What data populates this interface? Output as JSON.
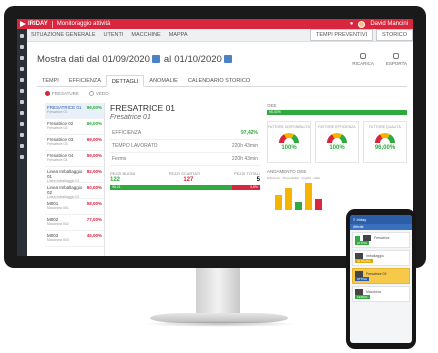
{
  "app": {
    "logo_text": "IRIDAY",
    "title": "Monitoraggio attività",
    "user_name": "David Mancini"
  },
  "nav": {
    "items": [
      "SITUAZIONE GENERALE",
      "UTENTI",
      "MACCHINE",
      "MAPPA"
    ],
    "right_buttons": [
      "TEMPI PREVENTIVI",
      "STORICO"
    ]
  },
  "date_filter": {
    "label": "Mostra dati dal",
    "from": "01/09/2020",
    "connector": "al",
    "to": "01/10/2020",
    "actions": [
      "RICARICA",
      "ESPORTA"
    ]
  },
  "tabs": [
    "TEMPI",
    "EFFICIENZA",
    "DETTAGLI",
    "ANOMALIE",
    "CALENDARIO STORICO"
  ],
  "active_tab": "DETTAGLI",
  "filters": [
    "FRESATURE",
    "VEDO"
  ],
  "machines": [
    {
      "name": "FRESATRICE 01",
      "sub": "Fresatrice 01",
      "pct": "96,00%",
      "status": "green"
    },
    {
      "name": "Fresatrice 02",
      "sub": "Fresatrice 02",
      "pct": "86,00%",
      "status": "green"
    },
    {
      "name": "Fresatrice 03",
      "sub": "Fresatrice 03",
      "pct": "69,00%",
      "status": "red"
    },
    {
      "name": "Fresatrice 04",
      "sub": "Fresatrice 04",
      "pct": "59,00%",
      "status": "red"
    },
    {
      "name": "Linea Imballaggio 01",
      "sub": "Linea Imballaggio 01",
      "pct": "82,00%",
      "status": "red"
    },
    {
      "name": "Linea Imballaggio 02",
      "sub": "Linea Imballaggio 02",
      "pct": "60,00%",
      "status": "red"
    },
    {
      "name": "M001",
      "sub": "Macchina 001",
      "pct": "58,00%",
      "status": "red"
    },
    {
      "name": "M002",
      "sub": "Macchina 002",
      "pct": "77,00%",
      "status": "red"
    },
    {
      "name": "M003",
      "sub": "Macchina 003",
      "pct": "45,00%",
      "status": "red"
    }
  ],
  "detail": {
    "title": "FRESATRICE 01",
    "subtitle": "Fresatrice 01",
    "efficiency_label": "EFFICIENZA",
    "efficiency_value": "97,42%",
    "worked_label": "TEMPO LAVORATO",
    "worked_value": "220h 43min",
    "stop_label": "Fermo",
    "stop_value": "220h 43min",
    "counters": [
      "PEZZI BUONI",
      "PEZZI SCARTATI",
      "PEZZI TOTALI"
    ],
    "good": "122",
    "rejected": "127",
    "total": "5",
    "good_pct": "98,21",
    "bad_pct": "3,8%"
  },
  "oee": {
    "label": "OEE",
    "value": "96,00%",
    "gauges": [
      {
        "label": "FATTORE DISPONIBILITÀ",
        "value": "100%"
      },
      {
        "label": "FATTORE EFFICIENZA",
        "value": "100%"
      },
      {
        "label": "FATTORE QUALITÀ",
        "value": "96,00%"
      }
    ],
    "trend_label": "ANDAMENTO OEE",
    "legend": "Efficienza · Disponibilità · Qualità · OEE"
  },
  "chart_data": {
    "type": "bar",
    "categories": [
      "1",
      "2",
      "3",
      "4",
      "5"
    ],
    "values": [
      55,
      80,
      30,
      95,
      40
    ],
    "colors": [
      "#f4b400",
      "#f4b400",
      "#2eaa3f",
      "#f4b400",
      "#d7263d"
    ]
  },
  "phone": {
    "title": "Iriday",
    "subtitle": "Attività",
    "cards": [
      {
        "name": "Fresatrice",
        "tag": "ATTIVA"
      },
      {
        "name": "Imballaggio",
        "tag": "IN PAUSA"
      },
      {
        "name": "Fresatrice 02",
        "tag": "ATTIVA"
      },
      {
        "name": "Macchina",
        "tag": "FERMA"
      }
    ]
  },
  "colors": {
    "accent": "#d7263d",
    "green": "#2eaa3f",
    "blue": "#2c5ea8",
    "yellow": "#f4b400"
  }
}
